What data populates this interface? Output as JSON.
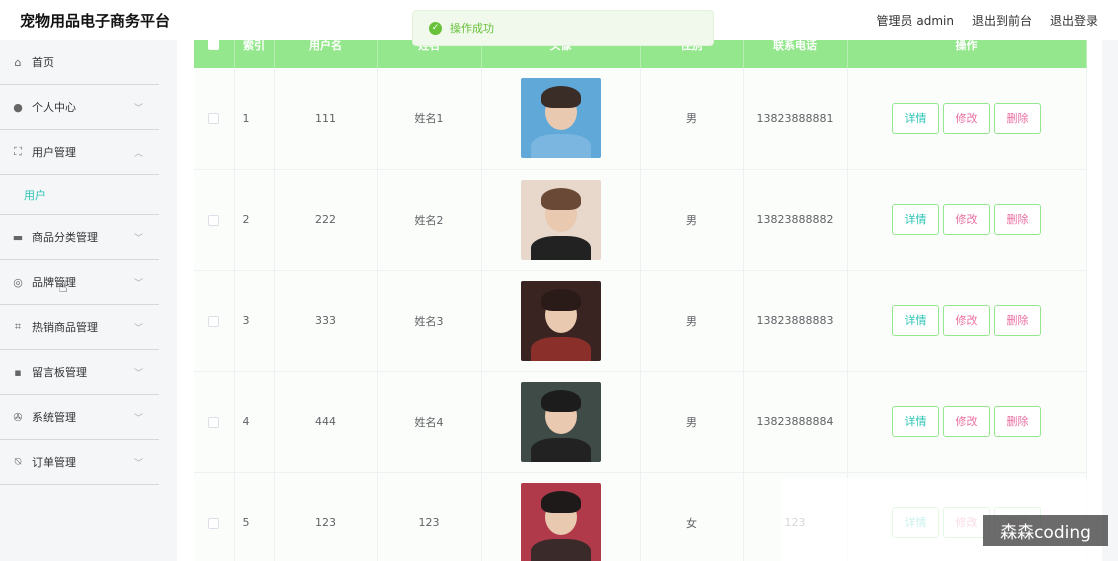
{
  "app": {
    "title": "宠物用品电子商务平台",
    "user_label": "管理员 admin",
    "front_link": "退出到前台",
    "logout_link": "退出登录"
  },
  "toast": {
    "message": "操作成功",
    "icon": "check-circle-icon",
    "color": "#67c23a"
  },
  "sidebar": {
    "items": [
      {
        "label": "首页",
        "icon": "home-icon",
        "glyph": "⌂",
        "chevron": ""
      },
      {
        "label": "个人中心",
        "icon": "person-icon",
        "glyph": "●",
        "chevron": "﹀"
      },
      {
        "label": "用户管理",
        "icon": "frame-icon",
        "glyph": "⛶",
        "chevron": "︿"
      },
      {
        "label": "商品分类管理",
        "icon": "briefcase-icon",
        "glyph": "▬",
        "chevron": "﹀"
      },
      {
        "label": "品牌管理",
        "icon": "lifebuoy-icon",
        "glyph": "◎",
        "chevron": "﹀"
      },
      {
        "label": "热销商品管理",
        "icon": "crop-icon",
        "glyph": "⌗",
        "chevron": "﹀"
      },
      {
        "label": "留言板管理",
        "icon": "monitor-icon",
        "glyph": "▪",
        "chevron": "﹀"
      },
      {
        "label": "系统管理",
        "icon": "compass-icon",
        "glyph": "✇",
        "chevron": "﹀"
      },
      {
        "label": "订单管理",
        "icon": "bell-off-icon",
        "glyph": "⍉",
        "chevron": "﹀"
      }
    ],
    "sub_item": {
      "label": "用户"
    }
  },
  "table": {
    "headers": [
      "",
      "索引",
      "用户名",
      "姓名",
      "头像",
      "性别",
      "联系电话",
      "操作"
    ],
    "actions": {
      "detail": "详情",
      "edit": "修改",
      "delete": "删除"
    },
    "rows": [
      {
        "index": "1",
        "username": "111",
        "name": "姓名1",
        "gender": "男",
        "phone": "13823888881",
        "avatar_colors": [
          "#5fa8d8",
          "#3a2d28",
          "#7ab6e0"
        ]
      },
      {
        "index": "2",
        "username": "222",
        "name": "姓名2",
        "gender": "男",
        "phone": "13823888882",
        "avatar_colors": [
          "#e8d8cc",
          "#6a4a36",
          "#222222"
        ]
      },
      {
        "index": "3",
        "username": "333",
        "name": "姓名3",
        "gender": "男",
        "phone": "13823888883",
        "avatar_colors": [
          "#3a2422",
          "#2a1b18",
          "#8a2f2a"
        ]
      },
      {
        "index": "4",
        "username": "444",
        "name": "姓名4",
        "gender": "男",
        "phone": "13823888884",
        "avatar_colors": [
          "#3f4b47",
          "#1c1c1c",
          "#222222"
        ]
      },
      {
        "index": "5",
        "username": "123",
        "name": "123",
        "gender": "女",
        "phone": "123",
        "avatar_colors": [
          "#b03a4a",
          "#1e1a1a",
          "#3a2a2a"
        ]
      }
    ]
  },
  "watermark": {
    "text": "森森coding"
  }
}
